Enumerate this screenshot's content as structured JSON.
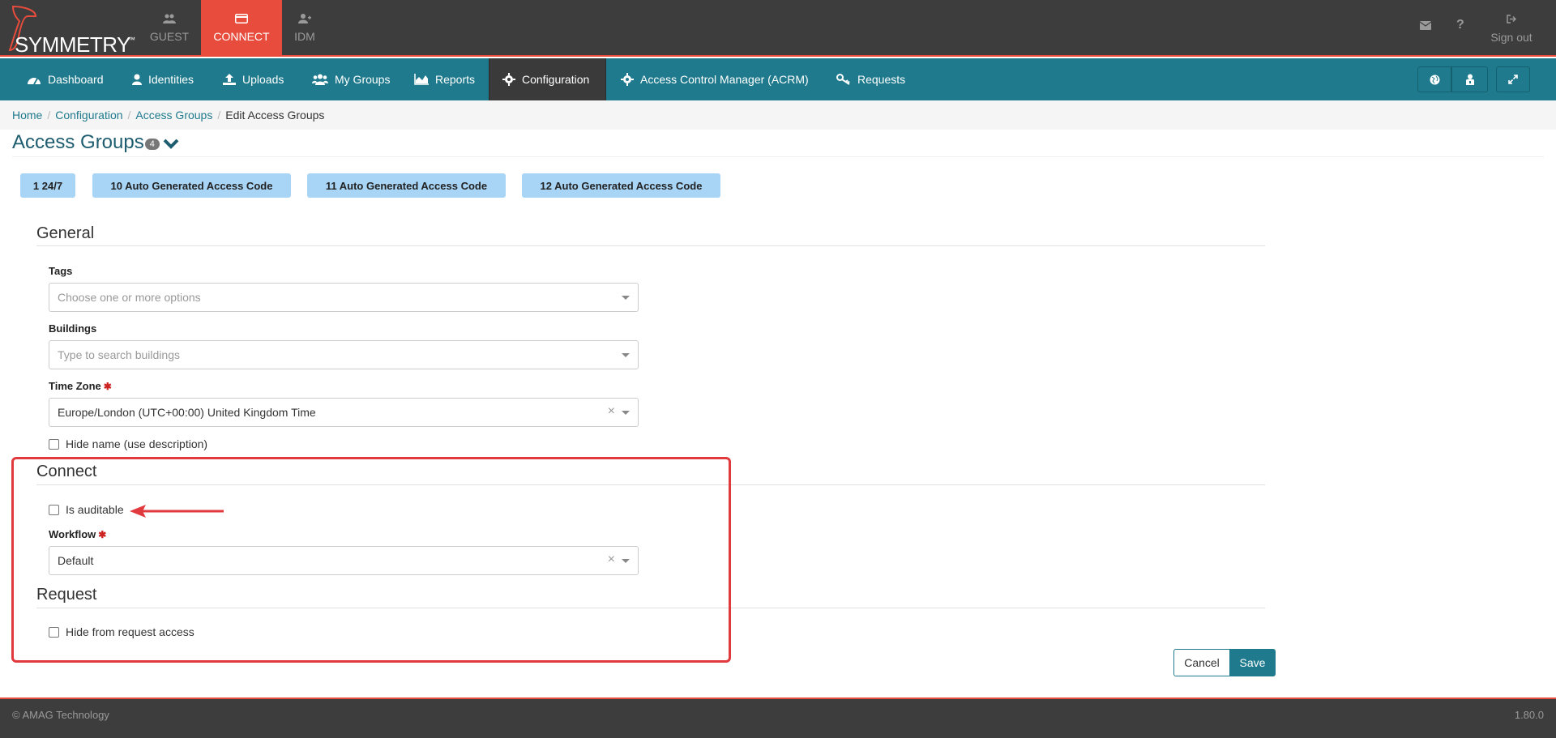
{
  "app": {
    "logo_text": "SYMMETRY",
    "logo_tm": "™"
  },
  "top_tabs": [
    {
      "label": "GUEST",
      "icon": "users-icon"
    },
    {
      "label": "CONNECT",
      "icon": "card-icon"
    },
    {
      "label": "IDM",
      "icon": "user-plus-icon"
    }
  ],
  "top_right": {
    "mail_icon": "envelope-icon",
    "help_icon": "question-icon",
    "signout_label": "Sign out"
  },
  "nav": {
    "items": [
      {
        "label": "Dashboard",
        "icon": "dashboard-icon"
      },
      {
        "label": "Identities",
        "icon": "user-icon"
      },
      {
        "label": "Uploads",
        "icon": "upload-icon"
      },
      {
        "label": "My Groups",
        "icon": "group-icon"
      },
      {
        "label": "Reports",
        "icon": "area-chart-icon"
      },
      {
        "label": "Configuration",
        "icon": "gear-icon"
      },
      {
        "label": "Access Control Manager (ACRM)",
        "icon": "gear-icon"
      },
      {
        "label": "Requests",
        "icon": "key-icon"
      }
    ],
    "active": "Configuration"
  },
  "breadcrumb": {
    "home": "Home",
    "configuration": "Configuration",
    "access_groups": "Access Groups",
    "current": "Edit Access Groups"
  },
  "page": {
    "title": "Access Groups",
    "badge": "4"
  },
  "chips": [
    "1 24/7",
    "10 Auto Generated Access Code",
    "11 Auto Generated Access Code",
    "12 Auto Generated Access Code"
  ],
  "general": {
    "title": "General",
    "tags_label": "Tags",
    "tags_placeholder": "Choose one or more options",
    "buildings_label": "Buildings",
    "buildings_placeholder": "Type to search buildings",
    "timezone_label": "Time Zone",
    "timezone_value": "Europe/London (UTC+00:00) United Kingdom Time",
    "hide_name_label": "Hide name (use description)"
  },
  "connect": {
    "title": "Connect",
    "is_auditable_label": "Is auditable",
    "workflow_label": "Workflow",
    "workflow_value": "Default"
  },
  "request": {
    "title": "Request",
    "hide_request_label": "Hide from request access"
  },
  "actions": {
    "cancel": "Cancel",
    "save": "Save"
  },
  "footer": {
    "copyright": "© AMAG Technology",
    "version": "1.80.0"
  },
  "colors": {
    "accent": "#1e7a8c",
    "brand_red": "#e74c3c",
    "highlight": "#e0393e"
  }
}
